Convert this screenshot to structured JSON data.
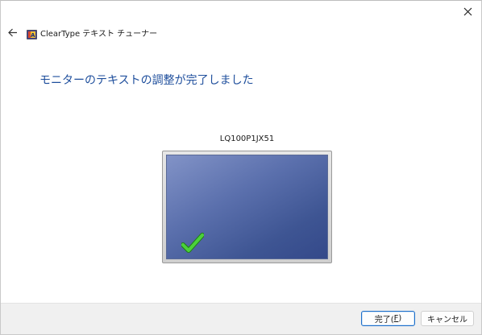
{
  "window": {
    "app_title": "ClearType テキスト チューナー",
    "close_icon": "close-icon",
    "back_icon": "arrow-left-icon",
    "app_icon": "cleartype-icon"
  },
  "main": {
    "heading": "モニターのテキストの調整が完了しました",
    "monitor_name": "LQ100P1JX51",
    "status_icon": "checkmark-icon",
    "colors": {
      "heading": "#1e4e9c",
      "check": "#3dbb2e",
      "screen_top": "#8293c7",
      "screen_bottom": "#34498a"
    }
  },
  "footer": {
    "finish_label": "完了(",
    "finish_mnemonic": "F",
    "finish_suffix": ")",
    "cancel_label": "キャンセル"
  }
}
